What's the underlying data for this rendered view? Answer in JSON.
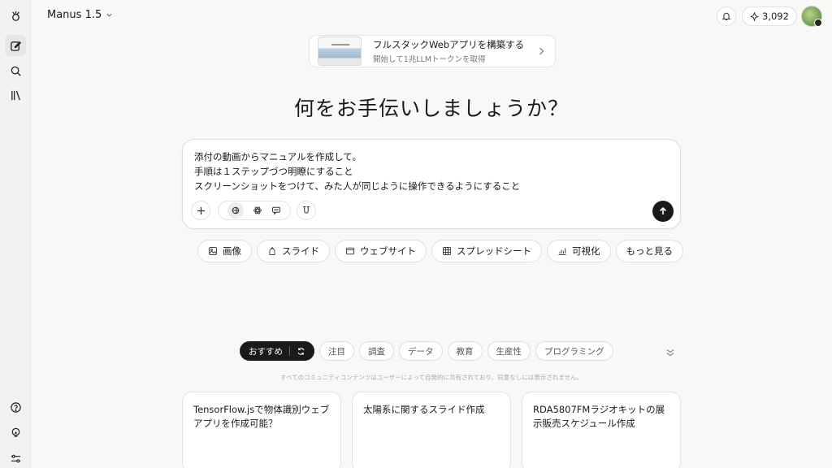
{
  "app": {
    "title": "Manus 1.5",
    "credits": "3,092"
  },
  "sidebar": {
    "items": [
      {
        "name": "new-task",
        "icon": "edit-icon"
      },
      {
        "name": "search",
        "icon": "search-icon"
      },
      {
        "name": "library",
        "icon": "library-icon"
      },
      {
        "name": "help",
        "icon": "help-icon"
      },
      {
        "name": "tips",
        "icon": "lightbulb-icon"
      },
      {
        "name": "settings",
        "icon": "sliders-icon"
      }
    ]
  },
  "banner": {
    "title": "フルスタックWebアプリを構築する",
    "subtitle": "開始して1兆LLMトークンを取得"
  },
  "headline": "何をお手伝いしましょうか？",
  "composer": {
    "text": "添付の動画からマニュアルを作成して。\n手順は１ステップづつ明瞭にすること\nスクリーンショットをつけて、みた人が同じように操作できるようにすること"
  },
  "chips": [
    {
      "label": "画像",
      "icon": "image-icon"
    },
    {
      "label": "スライド",
      "icon": "slide-icon"
    },
    {
      "label": "ウェブサイト",
      "icon": "browser-icon"
    },
    {
      "label": "スプレッドシート",
      "icon": "table-icon"
    },
    {
      "label": "可視化",
      "icon": "chart-icon"
    },
    {
      "label": "もっと見る",
      "icon": ""
    }
  ],
  "filters": {
    "active": "おすすめ",
    "items": [
      "注目",
      "調査",
      "データ",
      "教育",
      "生産性",
      "プログラミング"
    ]
  },
  "disclaimer": "すべてのコミュニティコンテンツはユーザーによって自発的に共有されており、同意なしには表示されません。",
  "cards": [
    "TensorFlow.jsで物体識別ウェブアプリを作成可能？",
    "太陽系に関するスライド作成",
    "RDA5807FMラジオキットの展示販売スケジュール作成"
  ],
  "colors": {
    "background": "#f8f8f7",
    "sidebar": "#f2f2f0",
    "accent": "#1a1a1a"
  }
}
